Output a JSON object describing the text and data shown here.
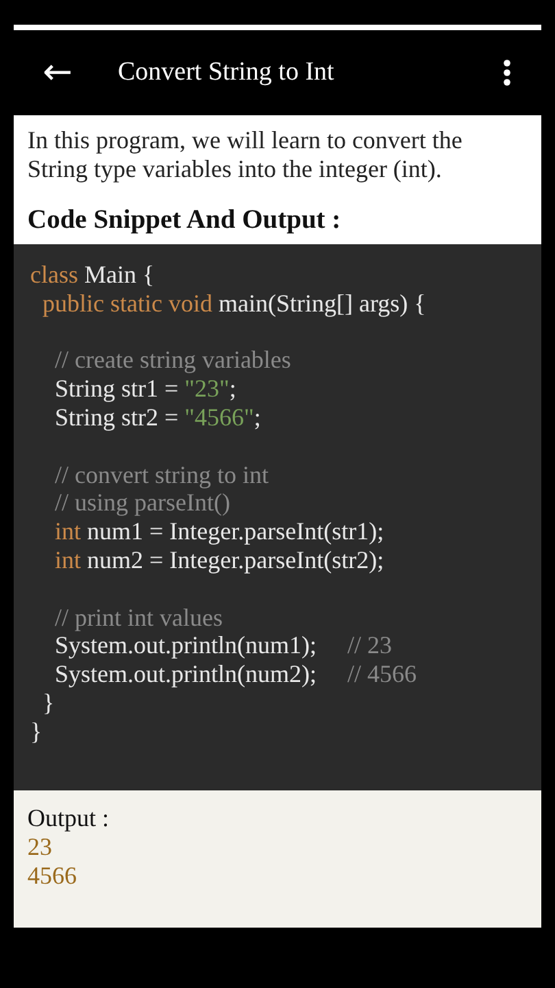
{
  "app_bar": {
    "back_icon": "←",
    "title": "Convert String to Int"
  },
  "intro": "In this program, we will learn to convert the String type variables into the integer (int).",
  "heading": "Code Snippet And Output :",
  "code_lines": [
    {
      "kind": "code",
      "tokens": [
        {
          "kind": "keyword",
          "text": "class"
        },
        {
          "kind": "plain",
          "text": " Main {"
        }
      ]
    },
    {
      "kind": "code",
      "tokens": [
        {
          "kind": "keyword",
          "text": "  public static void"
        },
        {
          "kind": "plain",
          "text": " main(String[] args) {"
        }
      ]
    },
    {
      "kind": "blank"
    },
    {
      "kind": "code",
      "tokens": [
        {
          "kind": "comment",
          "text": "    // create string variables"
        }
      ]
    },
    {
      "kind": "code",
      "tokens": [
        {
          "kind": "plain",
          "text": "    String str1 = "
        },
        {
          "kind": "string",
          "text": "\"23\""
        },
        {
          "kind": "plain",
          "text": ";"
        }
      ]
    },
    {
      "kind": "code",
      "tokens": [
        {
          "kind": "plain",
          "text": "    String str2 = "
        },
        {
          "kind": "string",
          "text": "\"4566\""
        },
        {
          "kind": "plain",
          "text": ";"
        }
      ]
    },
    {
      "kind": "blank"
    },
    {
      "kind": "code",
      "tokens": [
        {
          "kind": "comment",
          "text": "    // convert string to int"
        }
      ]
    },
    {
      "kind": "code",
      "tokens": [
        {
          "kind": "comment",
          "text": "    // using parseInt()"
        }
      ]
    },
    {
      "kind": "code",
      "tokens": [
        {
          "kind": "keyword",
          "text": "    int"
        },
        {
          "kind": "plain",
          "text": " num1 = Integer.parseInt(str1);"
        }
      ]
    },
    {
      "kind": "code",
      "tokens": [
        {
          "kind": "keyword",
          "text": "    int"
        },
        {
          "kind": "plain",
          "text": " num2 = Integer.parseInt(str2);"
        }
      ]
    },
    {
      "kind": "blank"
    },
    {
      "kind": "code",
      "tokens": [
        {
          "kind": "comment",
          "text": "    // print int values"
        }
      ]
    },
    {
      "kind": "code",
      "tokens": [
        {
          "kind": "plain",
          "text": "    System.out.println(num1);     "
        },
        {
          "kind": "comment",
          "text": "// 23"
        }
      ]
    },
    {
      "kind": "code",
      "tokens": [
        {
          "kind": "plain",
          "text": "    System.out.println(num2);     "
        },
        {
          "kind": "comment",
          "text": "// 4566"
        }
      ]
    },
    {
      "kind": "code",
      "tokens": [
        {
          "kind": "plain",
          "text": "  }"
        }
      ]
    },
    {
      "kind": "code",
      "tokens": [
        {
          "kind": "plain",
          "text": "}"
        }
      ]
    }
  ],
  "output": {
    "label": "Output :",
    "lines": [
      "23",
      "4566"
    ]
  }
}
